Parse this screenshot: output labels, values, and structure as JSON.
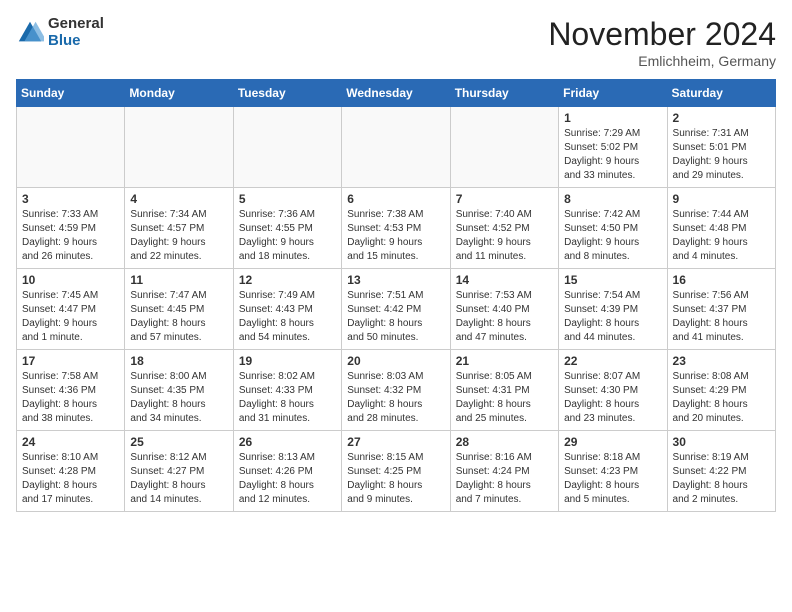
{
  "logo": {
    "general": "General",
    "blue": "Blue"
  },
  "title": "November 2024",
  "location": "Emlichheim, Germany",
  "days_of_week": [
    "Sunday",
    "Monday",
    "Tuesday",
    "Wednesday",
    "Thursday",
    "Friday",
    "Saturday"
  ],
  "weeks": [
    [
      {
        "day": "",
        "info": ""
      },
      {
        "day": "",
        "info": ""
      },
      {
        "day": "",
        "info": ""
      },
      {
        "day": "",
        "info": ""
      },
      {
        "day": "",
        "info": ""
      },
      {
        "day": "1",
        "info": "Sunrise: 7:29 AM\nSunset: 5:02 PM\nDaylight: 9 hours\nand 33 minutes."
      },
      {
        "day": "2",
        "info": "Sunrise: 7:31 AM\nSunset: 5:01 PM\nDaylight: 9 hours\nand 29 minutes."
      }
    ],
    [
      {
        "day": "3",
        "info": "Sunrise: 7:33 AM\nSunset: 4:59 PM\nDaylight: 9 hours\nand 26 minutes."
      },
      {
        "day": "4",
        "info": "Sunrise: 7:34 AM\nSunset: 4:57 PM\nDaylight: 9 hours\nand 22 minutes."
      },
      {
        "day": "5",
        "info": "Sunrise: 7:36 AM\nSunset: 4:55 PM\nDaylight: 9 hours\nand 18 minutes."
      },
      {
        "day": "6",
        "info": "Sunrise: 7:38 AM\nSunset: 4:53 PM\nDaylight: 9 hours\nand 15 minutes."
      },
      {
        "day": "7",
        "info": "Sunrise: 7:40 AM\nSunset: 4:52 PM\nDaylight: 9 hours\nand 11 minutes."
      },
      {
        "day": "8",
        "info": "Sunrise: 7:42 AM\nSunset: 4:50 PM\nDaylight: 9 hours\nand 8 minutes."
      },
      {
        "day": "9",
        "info": "Sunrise: 7:44 AM\nSunset: 4:48 PM\nDaylight: 9 hours\nand 4 minutes."
      }
    ],
    [
      {
        "day": "10",
        "info": "Sunrise: 7:45 AM\nSunset: 4:47 PM\nDaylight: 9 hours\nand 1 minute."
      },
      {
        "day": "11",
        "info": "Sunrise: 7:47 AM\nSunset: 4:45 PM\nDaylight: 8 hours\nand 57 minutes."
      },
      {
        "day": "12",
        "info": "Sunrise: 7:49 AM\nSunset: 4:43 PM\nDaylight: 8 hours\nand 54 minutes."
      },
      {
        "day": "13",
        "info": "Sunrise: 7:51 AM\nSunset: 4:42 PM\nDaylight: 8 hours\nand 50 minutes."
      },
      {
        "day": "14",
        "info": "Sunrise: 7:53 AM\nSunset: 4:40 PM\nDaylight: 8 hours\nand 47 minutes."
      },
      {
        "day": "15",
        "info": "Sunrise: 7:54 AM\nSunset: 4:39 PM\nDaylight: 8 hours\nand 44 minutes."
      },
      {
        "day": "16",
        "info": "Sunrise: 7:56 AM\nSunset: 4:37 PM\nDaylight: 8 hours\nand 41 minutes."
      }
    ],
    [
      {
        "day": "17",
        "info": "Sunrise: 7:58 AM\nSunset: 4:36 PM\nDaylight: 8 hours\nand 38 minutes."
      },
      {
        "day": "18",
        "info": "Sunrise: 8:00 AM\nSunset: 4:35 PM\nDaylight: 8 hours\nand 34 minutes."
      },
      {
        "day": "19",
        "info": "Sunrise: 8:02 AM\nSunset: 4:33 PM\nDaylight: 8 hours\nand 31 minutes."
      },
      {
        "day": "20",
        "info": "Sunrise: 8:03 AM\nSunset: 4:32 PM\nDaylight: 8 hours\nand 28 minutes."
      },
      {
        "day": "21",
        "info": "Sunrise: 8:05 AM\nSunset: 4:31 PM\nDaylight: 8 hours\nand 25 minutes."
      },
      {
        "day": "22",
        "info": "Sunrise: 8:07 AM\nSunset: 4:30 PM\nDaylight: 8 hours\nand 23 minutes."
      },
      {
        "day": "23",
        "info": "Sunrise: 8:08 AM\nSunset: 4:29 PM\nDaylight: 8 hours\nand 20 minutes."
      }
    ],
    [
      {
        "day": "24",
        "info": "Sunrise: 8:10 AM\nSunset: 4:28 PM\nDaylight: 8 hours\nand 17 minutes."
      },
      {
        "day": "25",
        "info": "Sunrise: 8:12 AM\nSunset: 4:27 PM\nDaylight: 8 hours\nand 14 minutes."
      },
      {
        "day": "26",
        "info": "Sunrise: 8:13 AM\nSunset: 4:26 PM\nDaylight: 8 hours\nand 12 minutes."
      },
      {
        "day": "27",
        "info": "Sunrise: 8:15 AM\nSunset: 4:25 PM\nDaylight: 8 hours\nand 9 minutes."
      },
      {
        "day": "28",
        "info": "Sunrise: 8:16 AM\nSunset: 4:24 PM\nDaylight: 8 hours\nand 7 minutes."
      },
      {
        "day": "29",
        "info": "Sunrise: 8:18 AM\nSunset: 4:23 PM\nDaylight: 8 hours\nand 5 minutes."
      },
      {
        "day": "30",
        "info": "Sunrise: 8:19 AM\nSunset: 4:22 PM\nDaylight: 8 hours\nand 2 minutes."
      }
    ]
  ]
}
